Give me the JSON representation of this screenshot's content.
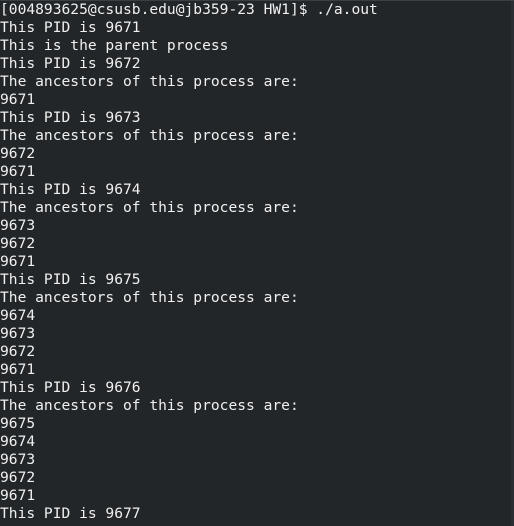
{
  "terminal": {
    "lines": [
      "[004893625@csusb.edu@jb359-23 HW1]$ ./a.out",
      "This PID is 9671",
      "This is the parent process",
      "This PID is 9672",
      "The ancestors of this process are:",
      "9671",
      "This PID is 9673",
      "The ancestors of this process are:",
      "9672",
      "9671",
      "This PID is 9674",
      "The ancestors of this process are:",
      "9673",
      "9672",
      "9671",
      "This PID is 9675",
      "The ancestors of this process are:",
      "9674",
      "9673",
      "9672",
      "9671",
      "This PID is 9676",
      "The ancestors of this process are:",
      "9675",
      "9674",
      "9673",
      "9672",
      "9671",
      "This PID is 9677"
    ]
  },
  "colors": {
    "background": "#222629",
    "text": "#f0f0f0"
  }
}
